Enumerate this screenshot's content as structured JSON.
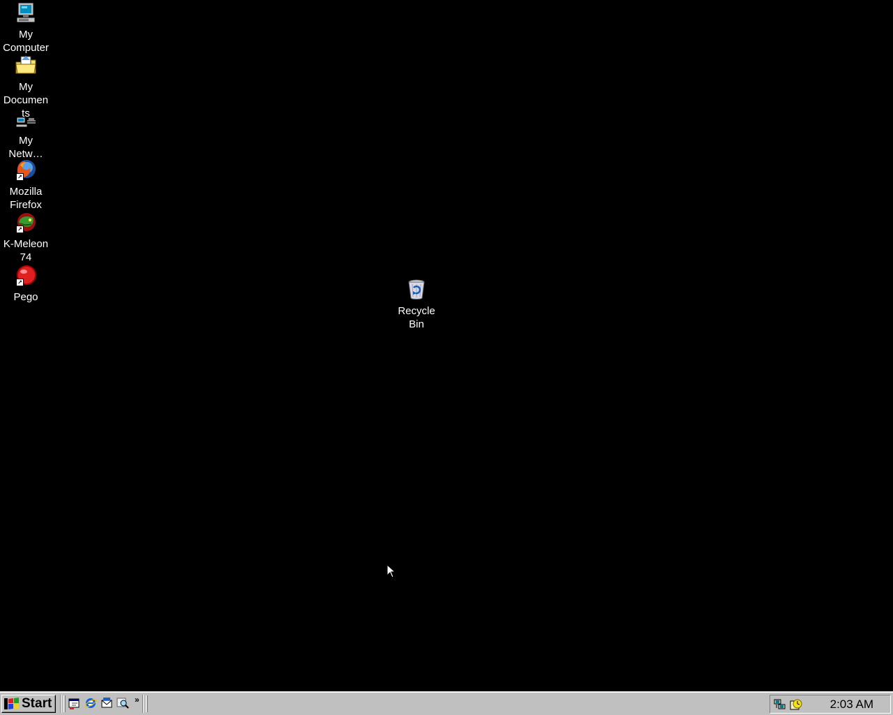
{
  "desktop": {
    "background_color": "#000000",
    "icons": [
      {
        "label": "My\nComputer",
        "icon": "my-computer-icon"
      },
      {
        "label": "My\nDocumen\nts",
        "icon": "my-documents-icon"
      },
      {
        "label": "My\nNetw…",
        "icon": "network-icon"
      },
      {
        "label": "Mozilla\nFirefox",
        "icon": "firefox-icon"
      },
      {
        "label": "K-Meleon\n74",
        "icon": "k-meleon-icon"
      },
      {
        "label": "Pego",
        "icon": "pego-icon"
      },
      {
        "label": "Recycle\nBin",
        "icon": "recycle-bin-icon"
      }
    ]
  },
  "taskbar": {
    "start_label": "Start",
    "quick_launch": [
      {
        "icon": "show-desktop-icon"
      },
      {
        "icon": "internet-explorer-icon"
      },
      {
        "icon": "outlook-express-icon"
      },
      {
        "icon": "search-icon"
      }
    ],
    "more_label": "»",
    "tray_icons": [
      {
        "icon": "network-tray-icon"
      },
      {
        "icon": "scheduler-tray-icon"
      }
    ],
    "clock": "2:03 AM"
  }
}
